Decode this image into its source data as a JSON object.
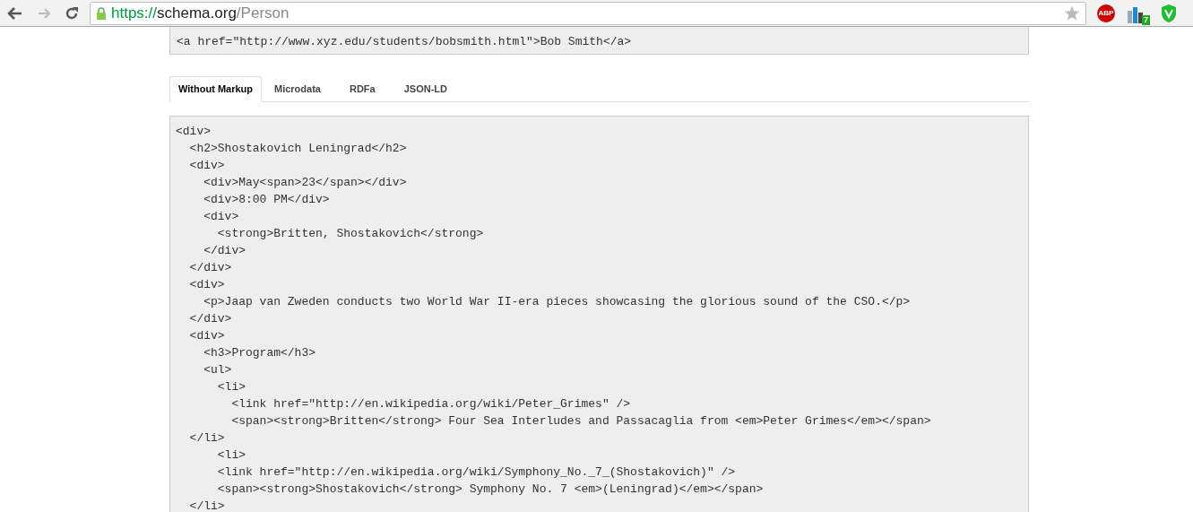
{
  "browser": {
    "url_scheme": "https://",
    "url_host": "schema.org",
    "url_path": "/Person",
    "extensions": [
      "ABP",
      "7"
    ]
  },
  "previous_code": {
    "lines": [
      "<a href=\"http://www.xyz.edu/students/bobsmith.html\">Bob Smith</a>"
    ]
  },
  "tabs": [
    {
      "label": "Without Markup",
      "selected": true
    },
    {
      "label": "Microdata",
      "selected": false
    },
    {
      "label": "RDFa",
      "selected": false
    },
    {
      "label": "JSON-LD",
      "selected": false
    }
  ],
  "code": {
    "lines": [
      "<div>",
      "  <h2>Shostakovich Leningrad</h2>",
      "  <div>",
      "    <div>May<span>23</span></div>",
      "    <div>8:00 PM</div>",
      "    <div>",
      "      <strong>Britten, Shostakovich</strong>",
      "    </div>",
      "  </div>",
      "  <div>",
      "    <p>Jaap van Zweden conducts two World War II-era pieces showcasing the glorious sound of the CSO.</p>",
      "  </div>",
      "  <div>",
      "    <h3>Program</h3>",
      "    <ul>",
      "      <li>",
      "        <link href=\"http://en.wikipedia.org/wiki/Peter_Grimes\" />",
      "        <span><strong>Britten</strong> Four Sea Interludes and Passacaglia from <em>Peter Grimes</em></span>",
      "  </li>",
      "      <li>",
      "      <link href=\"http://en.wikipedia.org/wiki/Symphony_No._7_(Shostakovich)\" />",
      "      <span><strong>Shostakovich</strong> Symphony No. 7 <em>(Leningrad)</em></span>",
      "  </li>"
    ]
  }
}
